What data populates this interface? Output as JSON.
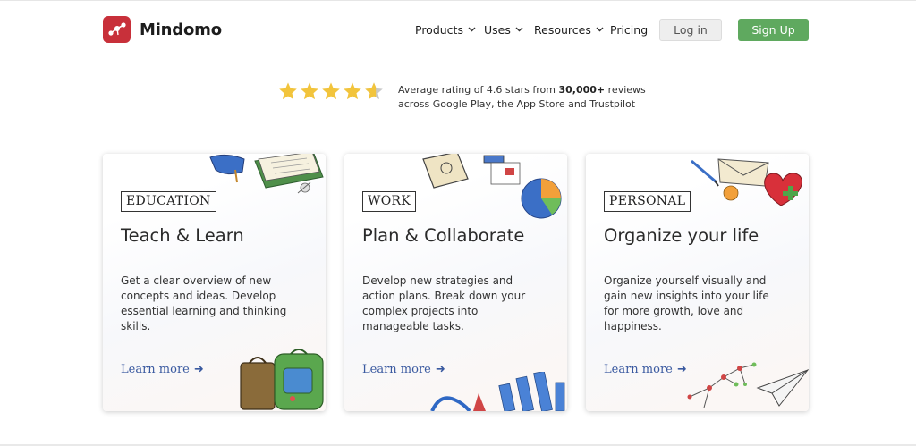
{
  "header": {
    "logo_text": "Mindomo",
    "nav": [
      {
        "label": "Products",
        "has_dropdown": true
      },
      {
        "label": "Uses",
        "has_dropdown": true
      },
      {
        "label": "Resources",
        "has_dropdown": true
      },
      {
        "label": "Pricing",
        "has_dropdown": false
      }
    ],
    "login_label": "Log in",
    "signup_label": "Sign Up"
  },
  "rating": {
    "stars": 4.6,
    "text_prefix": "Average rating of 4.6 stars from ",
    "text_bold": "30,000+",
    "text_suffix": " reviews",
    "line2": "across Google Play, the App Store and Trustpilot"
  },
  "cards": [
    {
      "tag": "EDUCATION",
      "title": "Teach & Learn",
      "description": "Get a clear overview of new concepts and ideas. Develop essential learning and thinking skills.",
      "link": "Learn more",
      "arrow": "➜"
    },
    {
      "tag": "WORK",
      "title": "Plan & Collaborate",
      "description": "Develop new strategies and action plans. Break down your complex projects into manageable tasks.",
      "link": "Learn more",
      "arrow": "➜"
    },
    {
      "tag": "PERSONAL",
      "title": "Organize your life",
      "description": "Organize yourself visually and gain new insights into your life for more growth, love and happiness.",
      "link": "Learn more",
      "arrow": "➜"
    }
  ],
  "colors": {
    "brand_red": "#c8303a",
    "signup_green": "#5fa95f",
    "star_gold": "#f2c43c",
    "link_blue": "#3a5aa0"
  },
  "icons": {
    "nav_dropdown": "chevron-down-icon",
    "star": "star-icon",
    "link_arrow": "arrow-right-icon"
  }
}
